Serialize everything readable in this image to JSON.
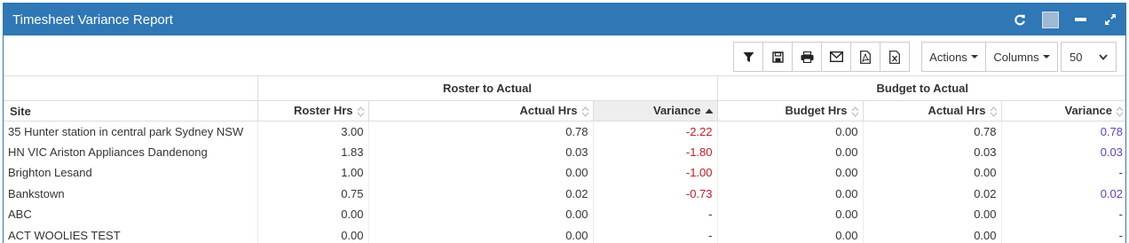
{
  "window": {
    "title": "Timesheet Variance Report"
  },
  "window_tools": [
    "refresh-icon",
    "color-swatch",
    "minimize-icon",
    "expand-icon"
  ],
  "toolbar": {
    "icons": [
      "filter-icon",
      "save-icon",
      "print-icon",
      "email-icon",
      "pdf-icon",
      "excel-icon"
    ],
    "actions_label": "Actions",
    "columns_label": "Columns",
    "page_size": "50"
  },
  "table": {
    "groups": {
      "roster": "Roster to Actual",
      "budget": "Budget to Actual"
    },
    "headers": {
      "site": "Site",
      "roster_hrs": "Roster Hrs",
      "actual_hrs_1": "Actual Hrs",
      "variance_1": "Variance",
      "budget_hrs": "Budget Hrs",
      "actual_hrs_2": "Actual Hrs",
      "variance_2": "Variance"
    },
    "sorted_column": "variance_1",
    "rows": [
      {
        "site": "35 Hunter station in central park Sydney NSW",
        "roster_hrs": "3.00",
        "actual_hrs_1": "0.78",
        "variance_1": "-2.22",
        "budget_hrs": "0.00",
        "actual_hrs_2": "0.78",
        "variance_2": "0.78"
      },
      {
        "site": "HN VIC Ariston Appliances Dandenong",
        "roster_hrs": "1.83",
        "actual_hrs_1": "0.03",
        "variance_1": "-1.80",
        "budget_hrs": "0.00",
        "actual_hrs_2": "0.03",
        "variance_2": "0.03"
      },
      {
        "site": "Brighton Lesand",
        "roster_hrs": "1.00",
        "actual_hrs_1": "0.00",
        "variance_1": "-1.00",
        "budget_hrs": "0.00",
        "actual_hrs_2": "0.00",
        "variance_2": "-"
      },
      {
        "site": "Bankstown",
        "roster_hrs": "0.75",
        "actual_hrs_1": "0.02",
        "variance_1": "-0.73",
        "budget_hrs": "0.00",
        "actual_hrs_2": "0.02",
        "variance_2": "0.02"
      },
      {
        "site": "ABC",
        "roster_hrs": "0.00",
        "actual_hrs_1": "0.00",
        "variance_1": "-",
        "budget_hrs": "0.00",
        "actual_hrs_2": "0.00",
        "variance_2": "-"
      },
      {
        "site": "ACT WOOLIES TEST",
        "roster_hrs": "0.00",
        "actual_hrs_1": "0.00",
        "variance_1": "-",
        "budget_hrs": "0.00",
        "actual_hrs_2": "0.00",
        "variance_2": "-"
      }
    ]
  },
  "colors": {
    "header_bg": "#2f77b5",
    "negative": "#c7181d",
    "positive": "#5a3fd0",
    "sorted_header_bg": "#eeeeee"
  }
}
